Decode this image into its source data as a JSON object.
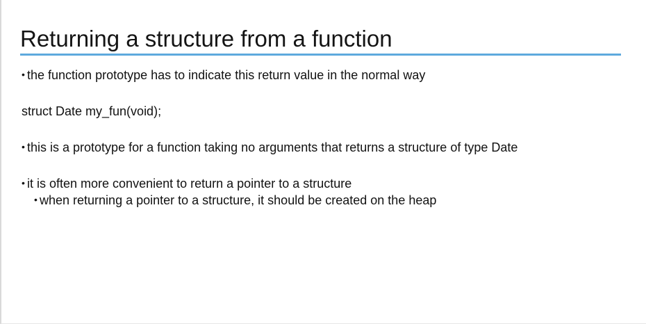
{
  "slide": {
    "title": "Returning a structure from a function",
    "bullet_glyph": "•",
    "lines": [
      "the function prototype has to indicate this return value in the normal way",
      "struct Date my_fun(void);",
      "this is a prototype for a function taking no arguments that returns a structure of type Date",
      "it is often more convenient to return a pointer to a structure",
      "when returning a pointer to a structure, it should be created on the heap"
    ]
  },
  "colors": {
    "title_rule": "#5ea9dd",
    "text": "#111111"
  }
}
